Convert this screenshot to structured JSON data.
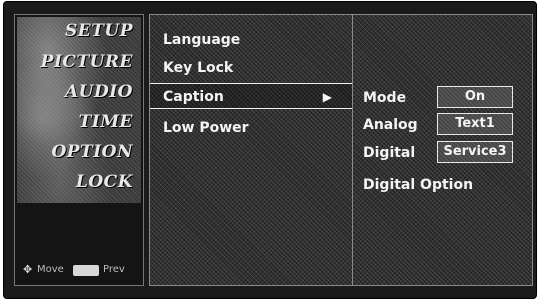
{
  "left_menu": {
    "categories": [
      "SETUP",
      "PICTURE",
      "AUDIO",
      "TIME",
      "OPTION",
      "LOCK"
    ],
    "footer": {
      "move_label": "Move",
      "prev_label": "Prev"
    }
  },
  "middle_menu": {
    "items": [
      "Language",
      "Key Lock",
      "Caption",
      "Low Power"
    ],
    "selected": "Caption",
    "arrow": "▶"
  },
  "caption_panel": {
    "rows": [
      {
        "label": "Mode",
        "value": "On"
      },
      {
        "label": "Analog",
        "value": "Text1"
      },
      {
        "label": "Digital",
        "value": "Service3"
      }
    ],
    "extra_item": "Digital Option"
  },
  "icons": {
    "move": "four-way-arrow-icon",
    "menu_key": "menu-key-icon",
    "selection": "right-arrow-icon"
  }
}
